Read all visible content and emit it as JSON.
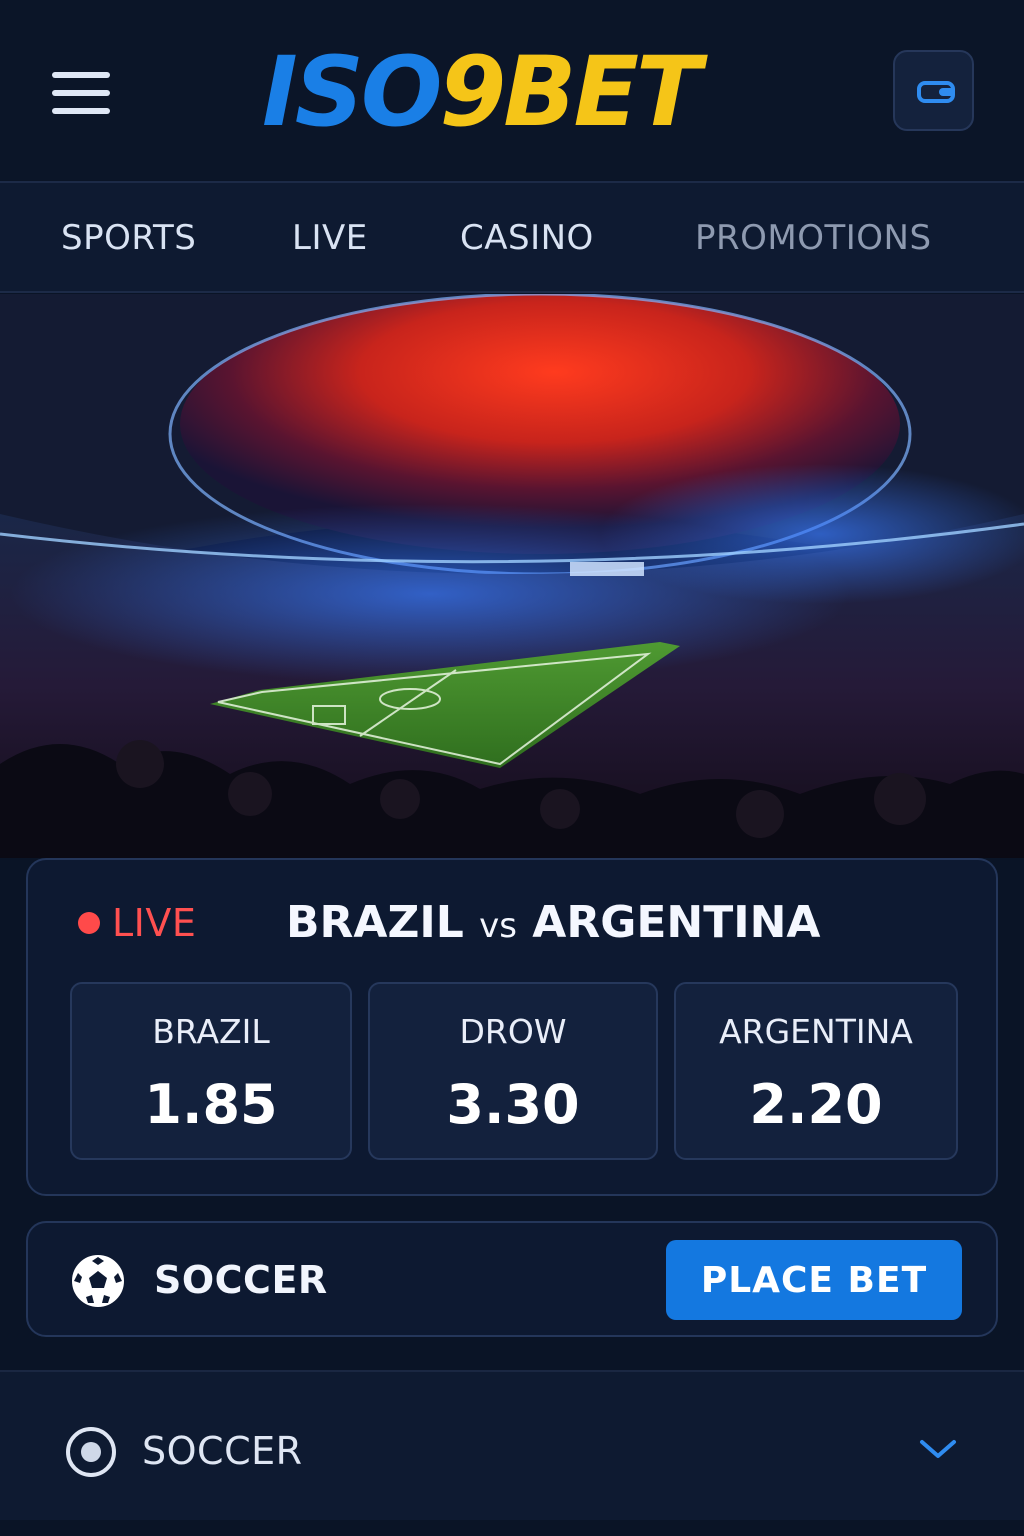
{
  "theme": {
    "brand_blue": "#1a7fe6",
    "brand_yellow": "#f5c518",
    "accent": "#1478e0",
    "live_red": "#ff5050",
    "background": "#0a1426"
  },
  "header": {
    "logo_part1": "ISO",
    "logo_part2": "9BET",
    "menu_icon": "hamburger-menu-icon",
    "wallet_icon": "wallet-icon"
  },
  "nav": {
    "items": [
      {
        "label": "SPORTS"
      },
      {
        "label": "LIVE"
      },
      {
        "label": "CASINO"
      },
      {
        "label": "PROMOTIONS"
      }
    ]
  },
  "match": {
    "live_label": "LIVE",
    "home": "BRAZIL",
    "vs": "vs",
    "away": "ARGENTINA",
    "odds": [
      {
        "label": "BRAZIL",
        "price": "1.85"
      },
      {
        "label": "DROW",
        "price": "3.30"
      },
      {
        "label": "ARGENTINA",
        "price": "2.20"
      }
    ]
  },
  "bet_bar": {
    "sport_icon": "soccer-ball-icon",
    "sport_label": "SOCCER",
    "place_bet_label": "PLACE BET"
  },
  "selector": {
    "label": "SOCCER",
    "icon": "radio-icon",
    "chevron": "chevron-down-icon"
  }
}
